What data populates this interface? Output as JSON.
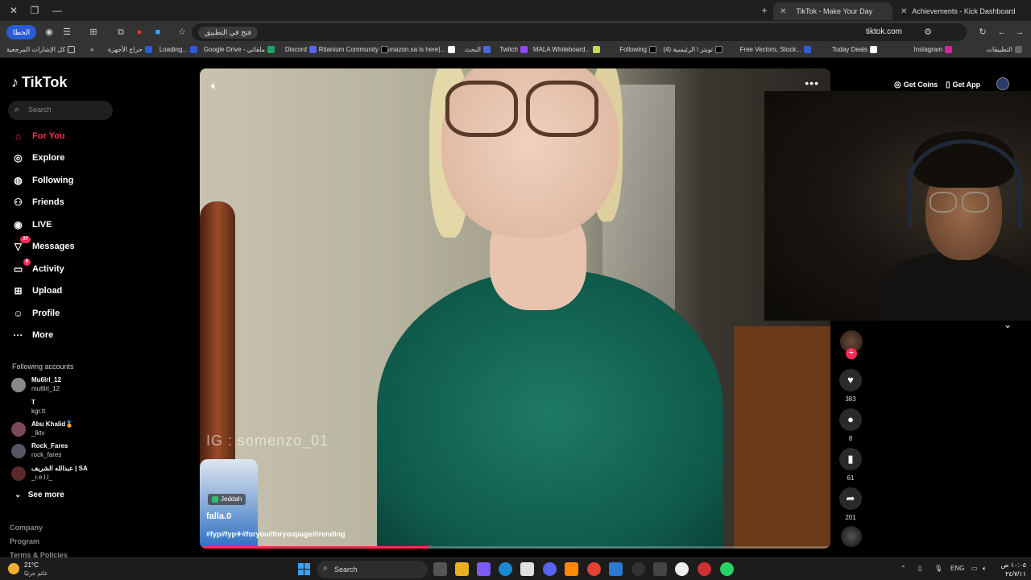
{
  "browser": {
    "tabs": [
      {
        "label": "TikTok - Make Your Day",
        "active": true
      },
      {
        "label": "Achievements - Kick Dashboard",
        "active": false
      }
    ],
    "url": "tiktok.com",
    "install_chip": "فتح في التطبيق",
    "profile_label": "الحطا",
    "bookmarks": [
      "التطبيقات",
      "Instagram",
      "Today Deals",
      "Free Vectors, Stock...",
      "تويتر \\ الرئيسية (4)",
      "Following",
      "MALA Whiteboard...",
      "Twitch",
      "البحث",
      "Amazon.sa is here|...",
      "Ritanium Community",
      "Discord",
      "Google Drive - ملفاتي",
      "Loading...",
      "حراج الأجهزة",
      "كل الإشارات المرجعية"
    ]
  },
  "sidebar": {
    "logo": "TikTok",
    "search_placeholder": "Search",
    "nav": [
      {
        "label": "For You",
        "icon": "home-icon",
        "active": true
      },
      {
        "label": "Explore",
        "icon": "compass-icon",
        "active": false
      },
      {
        "label": "Following",
        "icon": "following-icon",
        "active": false
      },
      {
        "label": "Friends",
        "icon": "friends-icon",
        "active": false
      },
      {
        "label": "LIVE",
        "icon": "live-icon",
        "active": false
      },
      {
        "label": "Messages",
        "icon": "messages-icon",
        "active": false,
        "badge": "27"
      },
      {
        "label": "Activity",
        "icon": "activity-icon",
        "active": false,
        "badge": "9"
      },
      {
        "label": "Upload",
        "icon": "upload-icon",
        "active": false
      },
      {
        "label": "Profile",
        "icon": "profile-icon",
        "active": false
      },
      {
        "label": "More",
        "icon": "more-icon",
        "active": false
      }
    ],
    "following_title": "Following accounts",
    "accounts": [
      {
        "name": "Mu6lrl_12",
        "user": "mu6lrl_12"
      },
      {
        "name": "T",
        "user": "kgr.tt"
      },
      {
        "name": "Abu Khalid🏅",
        "user": "_lktv"
      },
      {
        "name": "Rock_Fares",
        "user": "rock_fares"
      },
      {
        "name": "عبدالله الشريف | SA",
        "user": "_r.e.l.l_"
      }
    ],
    "see_more": "See more",
    "footer": [
      "Company",
      "Program",
      "Terms & Policies"
    ]
  },
  "video": {
    "watermark": "IG : somenzo_01",
    "location": "Jeddah",
    "author": "falla.0",
    "caption": "#fyp#fyp✈︎#foryou#foryoupage#trending",
    "progress": 0.36
  },
  "actions": {
    "likes": "383",
    "comments": "8",
    "saves": "61",
    "shares": "201"
  },
  "header": {
    "get_coins": "Get Coins",
    "get_app": "Get App"
  },
  "taskbar": {
    "temp": "21°C",
    "weather_desc": "غائم جزئيًا",
    "search_label": "Search",
    "lang": "ENG",
    "time": "١٠:٠٥ ص",
    "date": "٢٤/٧/١١"
  },
  "colors": {
    "accent": "#fe2c55",
    "bg": "#000000",
    "shirt": "#0f5a4a"
  }
}
